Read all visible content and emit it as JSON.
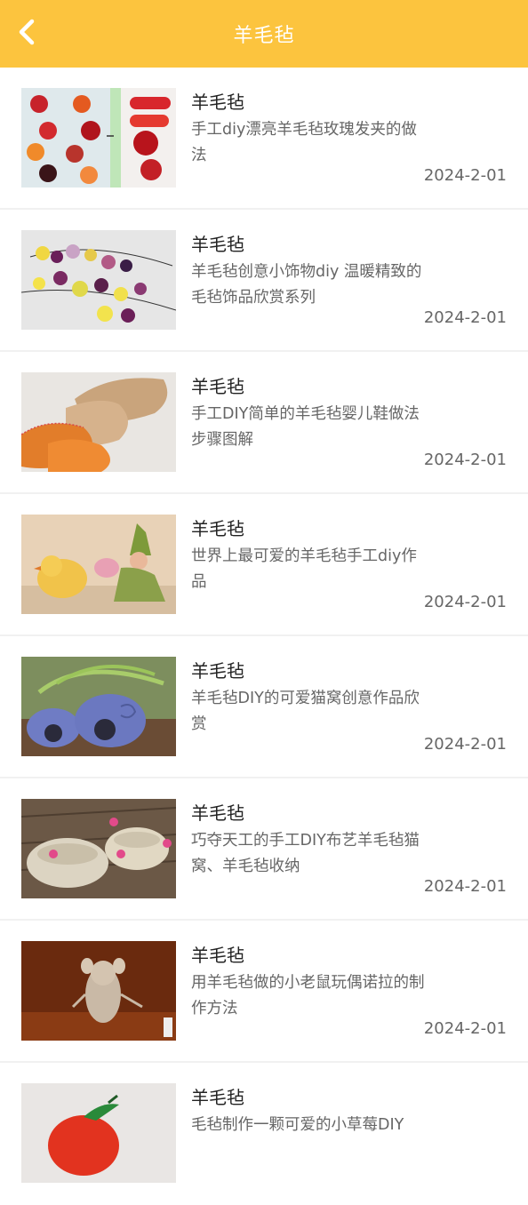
{
  "header": {
    "title": "羊毛毡",
    "back_icon": "chevron-left-icon",
    "background": "#FCC43E"
  },
  "items": [
    {
      "title": "羊毛毡",
      "desc": "手工diy漂亮羊毛毡玫瑰发夹的做法",
      "date": "2024-2-01",
      "thumb": "felt-rose-hairclips"
    },
    {
      "title": "羊毛毡",
      "desc": "羊毛毡创意小饰物diy 温暖精致的毛毡饰品欣赏系列",
      "date": "2024-2-01",
      "thumb": "felt-ball-necklace"
    },
    {
      "title": "羊毛毡",
      "desc": "手工DIY简单的羊毛毡婴儿鞋做法步骤图解",
      "date": "2024-2-01",
      "thumb": "felt-baby-shoes"
    },
    {
      "title": "羊毛毡",
      "desc": "世界上最可爱的羊毛毡手工diy作品",
      "date": "2024-2-01",
      "thumb": "felt-chick-and-elf"
    },
    {
      "title": "羊毛毡",
      "desc": "羊毛毡DIY的可爱猫窝创意作品欣赏",
      "date": "2024-2-01",
      "thumb": "felt-cat-caves"
    },
    {
      "title": "羊毛毡",
      "desc": "巧夺天工的手工DIY布艺羊毛毡猫窝、羊毛毡收纳",
      "date": "2024-2-01",
      "thumb": "felt-bowls-with-flowers"
    },
    {
      "title": "羊毛毡",
      "desc": "用羊毛毡做的小老鼠玩偶诺拉的制作方法",
      "date": "2024-2-01",
      "thumb": "felt-mouse-doll"
    },
    {
      "title": "羊毛毡",
      "desc": "毛毡制作一颗可爱的小草莓DIY",
      "date": "",
      "thumb": "felt-strawberry"
    }
  ]
}
